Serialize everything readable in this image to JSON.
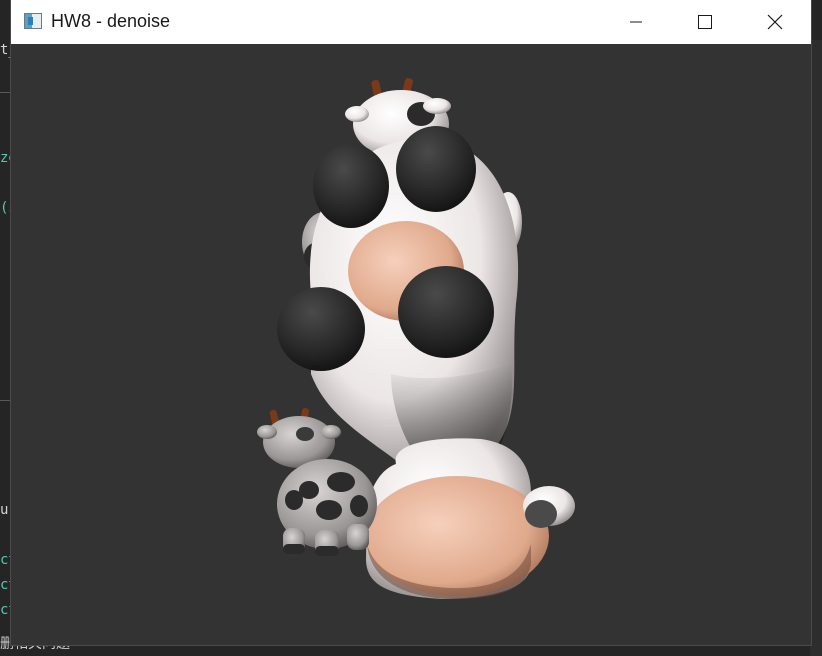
{
  "background_editor": {
    "lines": [
      {
        "text": "t_",
        "color": "#d4d4d4"
      },
      {
        "text": "ze",
        "color": "#4ec9b0"
      },
      {
        "text": "(s",
        "color": "#4ec9b0"
      },
      {
        "text": " (",
        "color": "#d4d4d4"
      },
      {
        "text": "u",
        "color": "#d4d4d4"
      },
      {
        "text": "ct",
        "color": "#4ec9b0"
      },
      {
        "text": "ct",
        "color": "#4ec9b0"
      },
      {
        "text": "ct",
        "color": "#4ec9b0"
      }
    ],
    "bottom_label": "删相关问题"
  },
  "window": {
    "title": "HW8 - denoise",
    "icon": "app-window-icon",
    "controls": {
      "minimize": "minimize-icon",
      "maximize": "maximize-icon",
      "close": "close-icon"
    }
  },
  "scene": {
    "description_icon": "cow-model-render",
    "background_color": "#333333",
    "colors": {
      "hide_white": "#f2eeee",
      "spot_dark": "#2b2b2b",
      "udder_pink": "#e8b49a",
      "horn_brown": "#7a3a1a"
    }
  }
}
